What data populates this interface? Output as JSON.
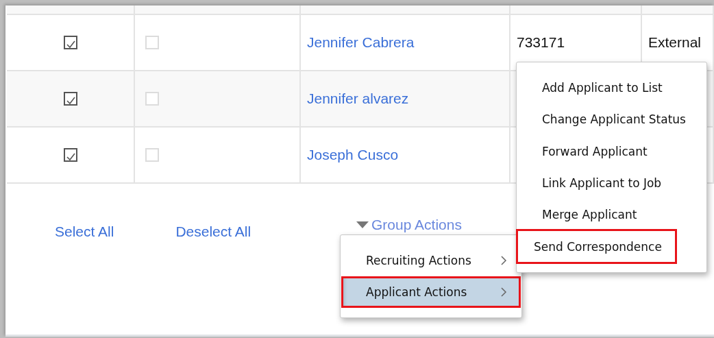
{
  "table": {
    "rows": [
      {
        "selected": true,
        "flagged": false,
        "name": "Jennifer Cabrera",
        "number": "733171",
        "type": "External"
      },
      {
        "selected": true,
        "flagged": false,
        "name": "Jennifer alvarez"
      },
      {
        "selected": true,
        "flagged": false,
        "name": "Joseph Cusco"
      }
    ]
  },
  "links": [
    "Select All",
    "Deselect All"
  ],
  "group_actions": {
    "label": "Group Actions"
  },
  "menu": {
    "items": [
      {
        "label": "Recruiting Actions",
        "selected": false,
        "outlined": false
      },
      {
        "label": "Applicant Actions",
        "selected": true,
        "outlined": true
      }
    ]
  },
  "submenu": {
    "items": [
      {
        "label": "Add Applicant to List",
        "outlined": false
      },
      {
        "label": "Change Applicant Status",
        "outlined": false
      },
      {
        "label": "Forward Applicant",
        "outlined": false
      },
      {
        "label": "Link Applicant to Job",
        "outlined": false
      },
      {
        "label": "Merge Applicant",
        "outlined": false
      },
      {
        "label": "Send Correspondence",
        "outlined": true
      }
    ]
  }
}
